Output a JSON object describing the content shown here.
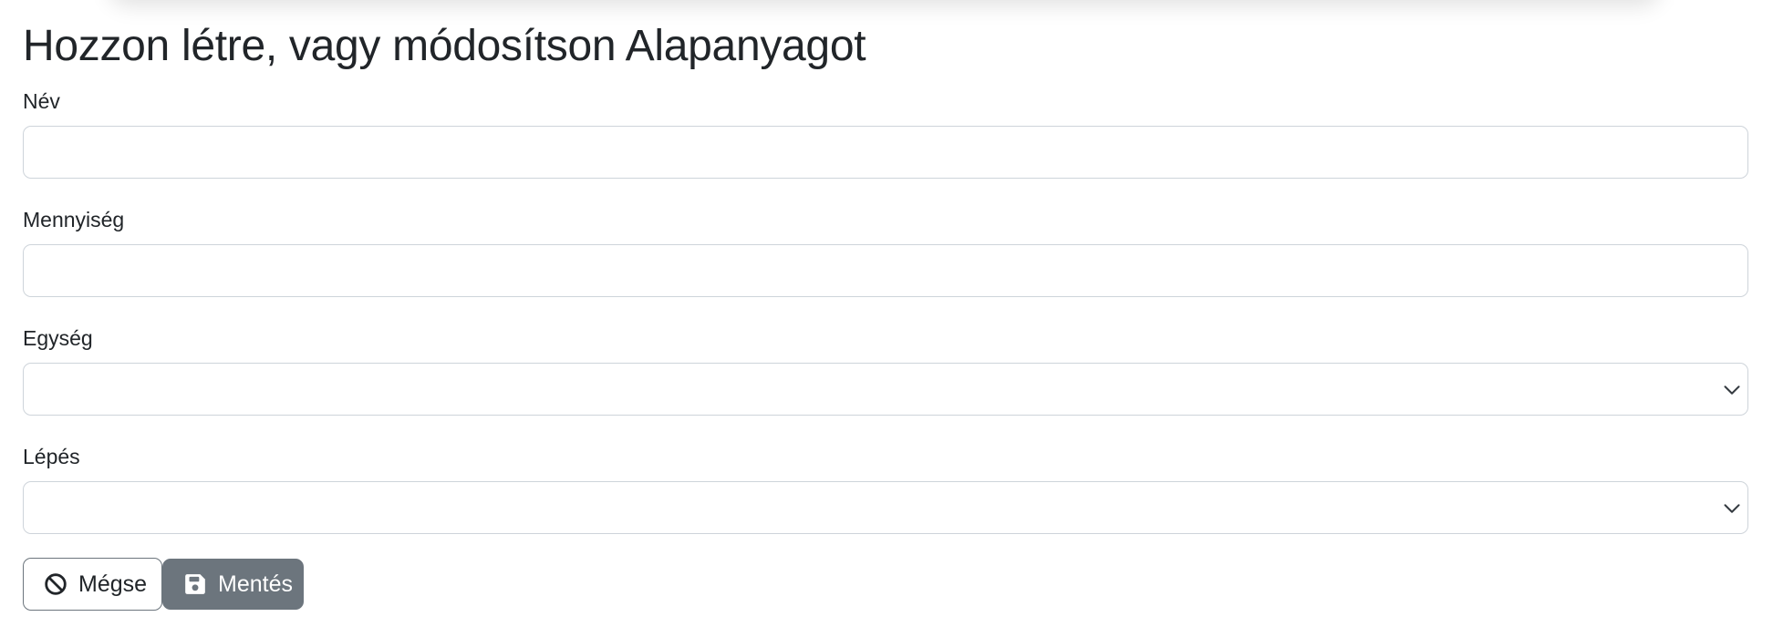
{
  "page": {
    "title": "Hozzon létre, vagy módosítson Alapanyagot"
  },
  "form": {
    "fields": [
      {
        "label": "Név",
        "type": "text",
        "value": "",
        "placeholder": ""
      },
      {
        "label": "Mennyiség",
        "type": "text",
        "value": "",
        "placeholder": ""
      },
      {
        "label": "Egység",
        "type": "select",
        "value": "",
        "icon": "chevron-down-icon"
      },
      {
        "label": "Lépés",
        "type": "select",
        "value": "",
        "icon": "chevron-down-icon"
      }
    ],
    "buttons": {
      "cancel_label": "Mégse",
      "cancel_icon": "ban-icon",
      "save_label": "Mentés",
      "save_icon": "floppy-disk-icon"
    }
  },
  "colors": {
    "text": "#212529",
    "border": "#ced4da",
    "secondary": "#6c757d",
    "background": "#ffffff"
  }
}
